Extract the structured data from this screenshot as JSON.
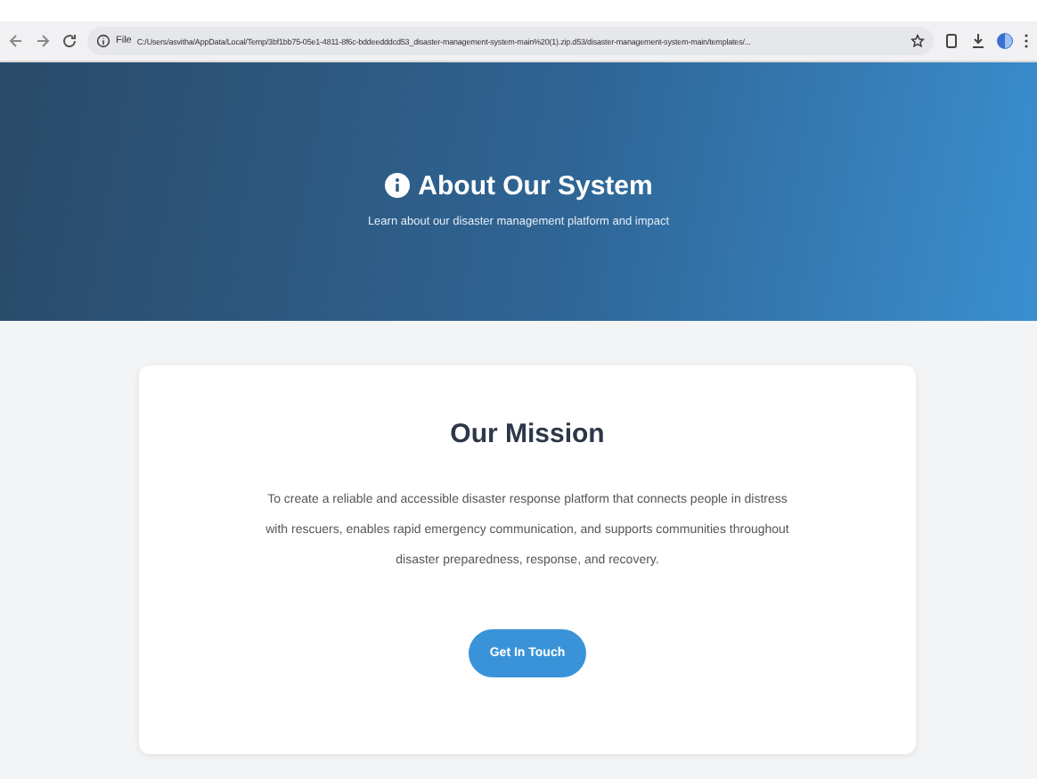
{
  "browser": {
    "url_prefix": "File",
    "url": "C:/Users/asvitha/AppData/Local/Temp/3bf1bb75-05e1-4811-8f6c-bddeedddcd53_disaster-management-system-main%20(1).zip.d53/disaster-management-system-main/templates/..."
  },
  "hero": {
    "title": "About Our System",
    "subtitle": "Learn about our disaster management platform and impact"
  },
  "mission": {
    "title": "Our Mission",
    "text": "To create a reliable and accessible disaster response platform that connects people in distress with rescuers, enables rapid emergency communication, and supports communities throughout disaster preparedness, response, and recovery.",
    "button": "Get In Touch"
  }
}
